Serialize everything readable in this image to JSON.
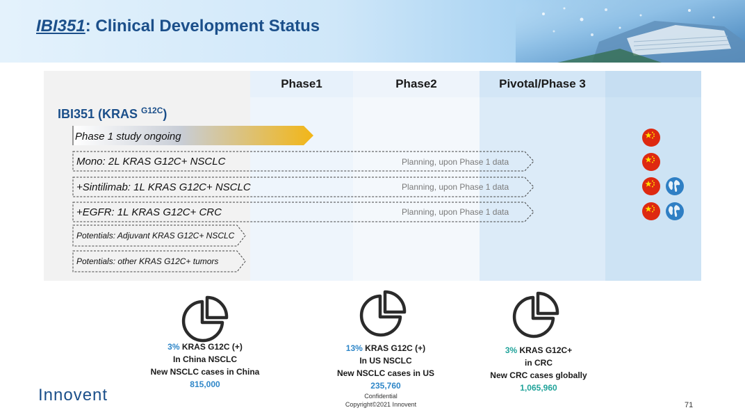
{
  "header": {
    "title_product": "IBI351",
    "title_rest": ": Clinical Development Status"
  },
  "table": {
    "columns": [
      "Phase1",
      "Phase2",
      "Pivotal/Phase 3"
    ],
    "drug_name": "IBI351 (KRAS ",
    "drug_sup": "G12C",
    "drug_close": ")",
    "rows": [
      {
        "label": "Phase 1 study ongoing",
        "note": "",
        "regions": [
          "china"
        ]
      },
      {
        "label": "Mono: 2L KRAS G12C+ NSCLC",
        "note": "Planning, upon Phase 1 data",
        "regions": [
          "china"
        ]
      },
      {
        "label": "+Sintilimab: 1L KRAS G12C+ NSCLC",
        "note": "Planning, upon Phase 1 data",
        "regions": [
          "china",
          "global"
        ]
      },
      {
        "label": "+EGFR: 1L KRAS G12C+ CRC",
        "note": "Planning, upon Phase 1 data",
        "regions": [
          "china",
          "global"
        ]
      },
      {
        "label": "Potentials: Adjuvant KRAS G12C+ NSCLC",
        "note": "",
        "regions": []
      },
      {
        "label": "Potentials: other KRAS G12C+ tumors",
        "note": "",
        "regions": []
      }
    ]
  },
  "stats": [
    {
      "pct": "3%",
      "line1": " KRAS G12C (+)",
      "line2": "In China NSCLC",
      "line3": "New NSCLC cases in China",
      "total": "815,000"
    },
    {
      "pct": "13%",
      "line1": " KRAS G12C (+)",
      "line2": "In US NSCLC",
      "line3": "New NSCLC cases in US",
      "total": "235,760"
    },
    {
      "pct": "3%",
      "line1": " KRAS G12C+",
      "line2": "in CRC",
      "line3": "New CRC cases globally",
      "total": "1,065,960"
    }
  ],
  "footer": {
    "logo": "Innovent",
    "confidential": "Confidential",
    "copyright": "Copyright©2021 Innovent",
    "page_number": "71"
  },
  "colors": {
    "brand_blue": "#1b4f8a",
    "accent_blue": "#2e86c8",
    "accent_teal": "#20a39a",
    "progress_gold": "#f0b820",
    "china_flag_red": "#de2910"
  },
  "icons": [
    "china-flag-icon",
    "globe-icon",
    "pie-chart-icon"
  ]
}
